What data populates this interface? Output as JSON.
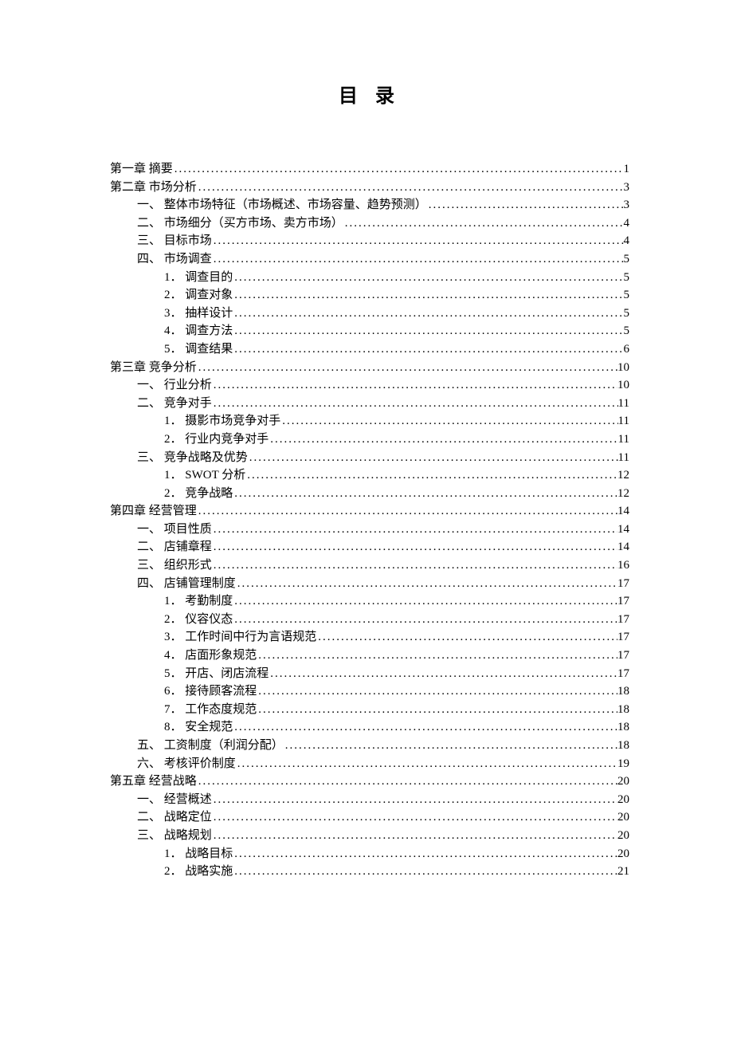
{
  "title": "目 录",
  "toc": [
    {
      "level": 0,
      "label": "第一章 摘要",
      "page": "1"
    },
    {
      "level": 0,
      "label": "第二章 市场分析",
      "page": "3"
    },
    {
      "level": 1,
      "label": "一、 整体市场特征（市场概述、市场容量、趋势预测） ",
      "page": "3"
    },
    {
      "level": 1,
      "label": "二、 市场细分（买方市场、卖方市场）",
      "page": "4"
    },
    {
      "level": 1,
      "label": "三、 目标市场 ",
      "page": "4"
    },
    {
      "level": 1,
      "label": "四、 市场调查",
      "page": "5"
    },
    {
      "level": 2,
      "label": "1． 调查目的",
      "page": "5"
    },
    {
      "level": 2,
      "label": "2． 调查对象",
      "page": "5"
    },
    {
      "level": 2,
      "label": "3． 抽样设计",
      "page": "5"
    },
    {
      "level": 2,
      "label": "4． 调查方法",
      "page": "5"
    },
    {
      "level": 2,
      "label": "5． 调查结果",
      "page": "6"
    },
    {
      "level": 0,
      "label": "第三章 竞争分析",
      "page": "10"
    },
    {
      "level": 1,
      "label": "一、 行业分析",
      "page": "10"
    },
    {
      "level": 1,
      "label": "二、 竞争对手",
      "page": "11"
    },
    {
      "level": 2,
      "label": "1． 摄影市场竞争对手",
      "page": "11"
    },
    {
      "level": 2,
      "label": "2． 行业内竞争对手",
      "page": "11"
    },
    {
      "level": 1,
      "label": "三、 竞争战略及优势",
      "page": "11"
    },
    {
      "level": 2,
      "label": "1． SWOT 分析 ",
      "page": "12"
    },
    {
      "level": 2,
      "label": "2． 竞争战略",
      "page": "12"
    },
    {
      "level": 0,
      "label": "第四章 经营管理",
      "page": "14"
    },
    {
      "level": 1,
      "label": "一、 项目性质",
      "page": "14"
    },
    {
      "level": 1,
      "label": "二、 店铺章程",
      "page": "14"
    },
    {
      "level": 1,
      "label": "三、 组织形式",
      "page": "16"
    },
    {
      "level": 1,
      "label": "四、 店铺管理制度",
      "page": "17"
    },
    {
      "level": 2,
      "label": "1． 考勤制度",
      "page": "17"
    },
    {
      "level": 2,
      "label": "2． 仪容仪态",
      "page": "17"
    },
    {
      "level": 2,
      "label": "3． 工作时间中行为言语规范",
      "page": "17"
    },
    {
      "level": 2,
      "label": "4． 店面形象规范",
      "page": "17"
    },
    {
      "level": 2,
      "label": "5． 开店、闭店流程",
      "page": "17"
    },
    {
      "level": 2,
      "label": "6． 接待顾客流程",
      "page": "18"
    },
    {
      "level": 2,
      "label": "7． 工作态度规范",
      "page": "18"
    },
    {
      "level": 2,
      "label": "8． 安全规范",
      "page": "18"
    },
    {
      "level": 1,
      "label": "五、 工资制度（利润分配）",
      "page": "18"
    },
    {
      "level": 1,
      "label": "六、 考核评价制度",
      "page": "19"
    },
    {
      "level": 0,
      "label": "第五章 经营战略",
      "page": "20"
    },
    {
      "level": 1,
      "label": "一、 经营概述",
      "page": "20"
    },
    {
      "level": 1,
      "label": "二、 战略定位",
      "page": "20"
    },
    {
      "level": 1,
      "label": "三、 战略规划",
      "page": "20"
    },
    {
      "level": 2,
      "label": "1． 战略目标",
      "page": "20"
    },
    {
      "level": 2,
      "label": "2． 战略实施",
      "page": "21"
    }
  ]
}
